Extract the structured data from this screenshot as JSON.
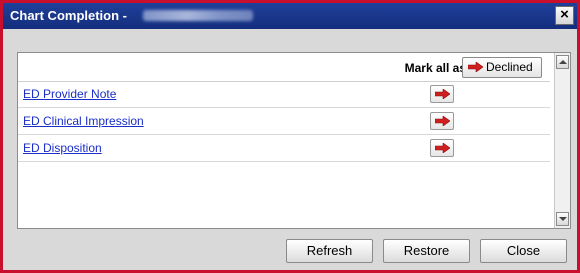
{
  "window": {
    "title": "Chart Completion -",
    "close_glyph": "×"
  },
  "header": {
    "mark_all_label": "Mark all as:",
    "declined_label": "Declined"
  },
  "items": [
    {
      "label": "ED Provider Note"
    },
    {
      "label": "ED Clinical Impression"
    },
    {
      "label": "ED Disposition"
    }
  ],
  "buttons": {
    "refresh": "Refresh",
    "restore": "Restore",
    "close": "Close"
  },
  "colors": {
    "title_bar": "#1f3f9a",
    "window_border": "#c8102e",
    "arrow": "#d11f1f",
    "link": "#1a2ec8"
  },
  "icons": {
    "arrow": "right-arrow-icon",
    "close": "close-icon",
    "scroll_up": "scroll-up-icon",
    "scroll_down": "scroll-down-icon"
  }
}
